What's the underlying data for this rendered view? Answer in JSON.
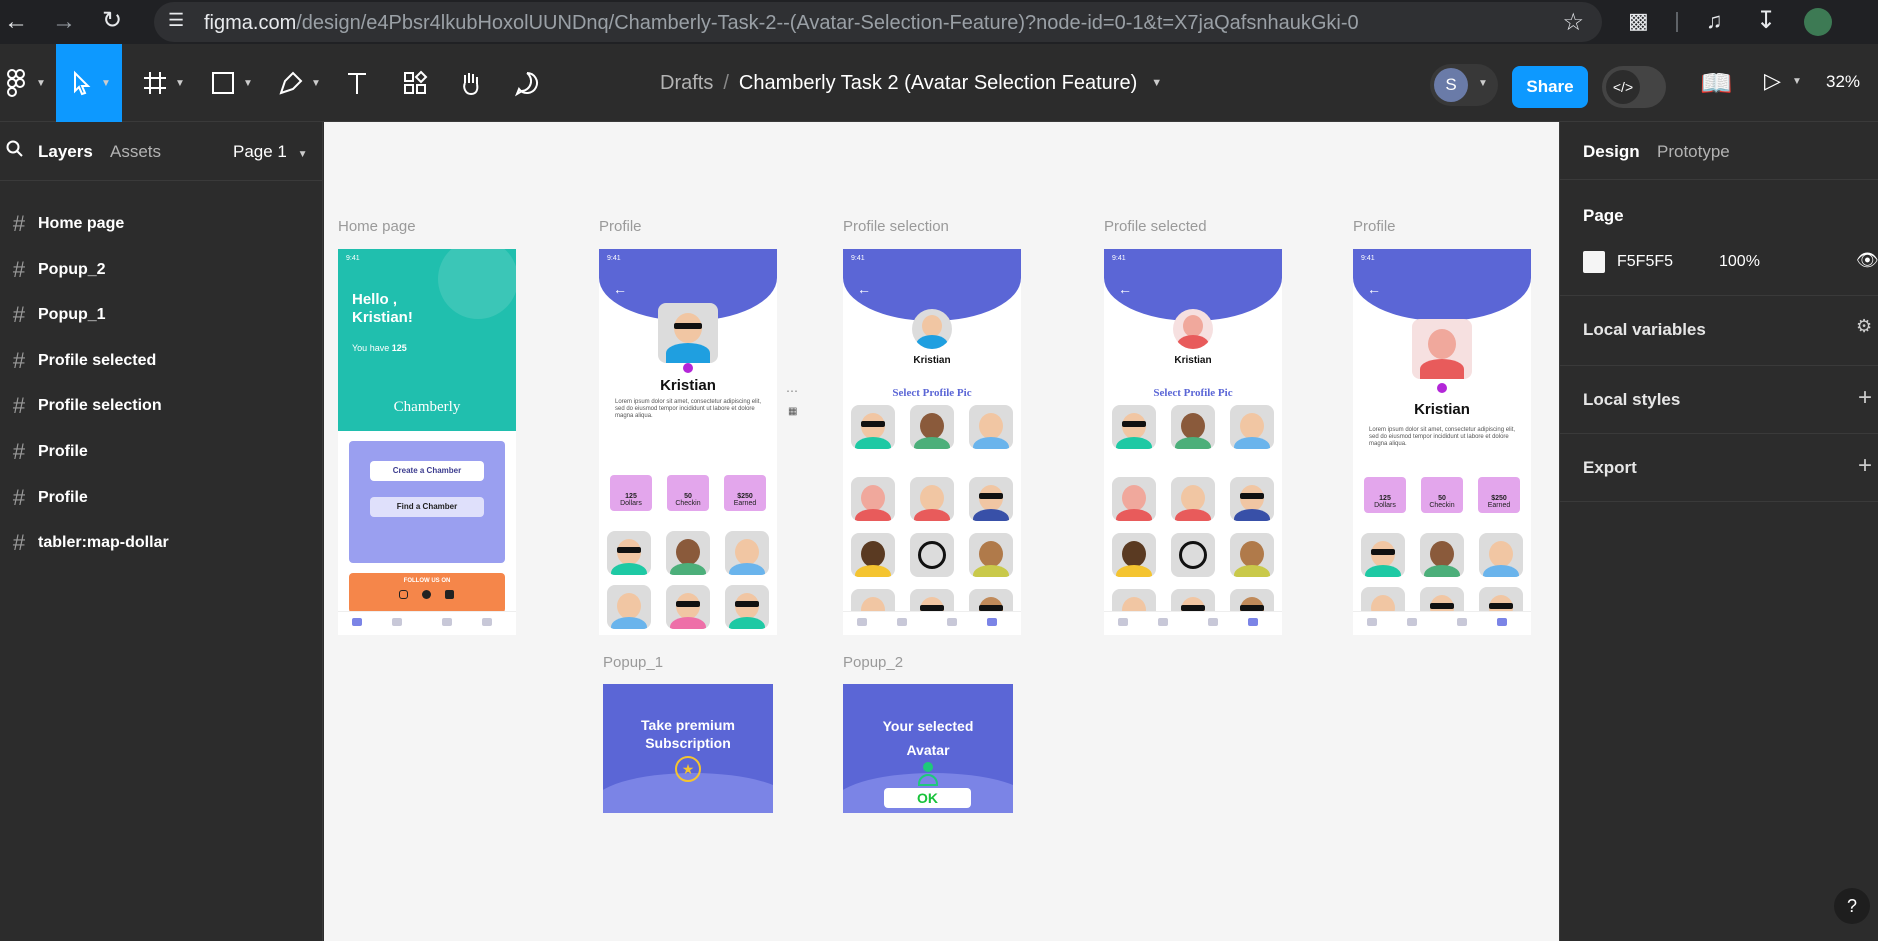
{
  "browser": {
    "url_host": "figma.com",
    "url_path": "/design/e4Pbsr4lkubHoxolUUNDnq/Chamberly-Task-2--(Avatar-Selection-Feature)?node-id=0-1&t=X7jaQafsnhaukGki-0"
  },
  "toolbar": {
    "breadcrumb_root": "Drafts",
    "breadcrumb_sep": "/",
    "file_name": "Chamberly Task 2 (Avatar Selection Feature)",
    "avatar_initial": "S",
    "share_label": "Share",
    "zoom": "32%"
  },
  "left_panel": {
    "tab_layers": "Layers",
    "tab_assets": "Assets",
    "page_selector": "Page 1",
    "layers": [
      {
        "name": "Home page"
      },
      {
        "name": "Popup_2"
      },
      {
        "name": "Popup_1"
      },
      {
        "name": "Profile selected"
      },
      {
        "name": "Profile selection"
      },
      {
        "name": "Profile"
      },
      {
        "name": "Profile"
      },
      {
        "name": "tabler:map-dollar"
      }
    ]
  },
  "right_panel": {
    "tab_design": "Design",
    "tab_prototype": "Prototype",
    "page_heading": "Page",
    "page_color": "F5F5F5",
    "page_opacity": "100%",
    "local_variables": "Local variables",
    "local_styles": "Local styles",
    "export": "Export",
    "help": "?"
  },
  "canvas": {
    "frame_labels": [
      "Home page",
      "Profile",
      "Profile selection",
      "Profile selected",
      "Profile"
    ],
    "popup_labels": [
      "Popup_1",
      "Popup_2"
    ],
    "status_time": "9:41",
    "home": {
      "greeting": "Hello ,\nKristian!",
      "you_have": "You have",
      "count": "125",
      "brand": "Chamberly",
      "create_btn": "Create a Chamber",
      "find_btn": "Find a Chamber",
      "follow": "FOLLOW US ON"
    },
    "profile_name": "Kristian",
    "lorem": "Lorem ipsum dolor sit amet, consectetur adipiscing elit, sed do eiusmod tempor incididunt ut labore et dolore magna aliqua.",
    "stats": [
      {
        "value": "125",
        "label": "Dollars"
      },
      {
        "value": "50",
        "label": "Checkin"
      },
      {
        "value": "$250",
        "label": "Earned"
      }
    ],
    "select_heading": "Select Profile Pic",
    "popup1_text": "Take premium Subscription",
    "popup2_text": "Your selected Avatar",
    "popup2_ok": "OK"
  },
  "colors": {
    "accent": "#0d99ff",
    "frame_purple": "#5b66d6",
    "home_teal": "#20bfae",
    "orange": "#f5864a",
    "stat_pink": "#e3a6ec",
    "ok_green": "#17c23a"
  }
}
